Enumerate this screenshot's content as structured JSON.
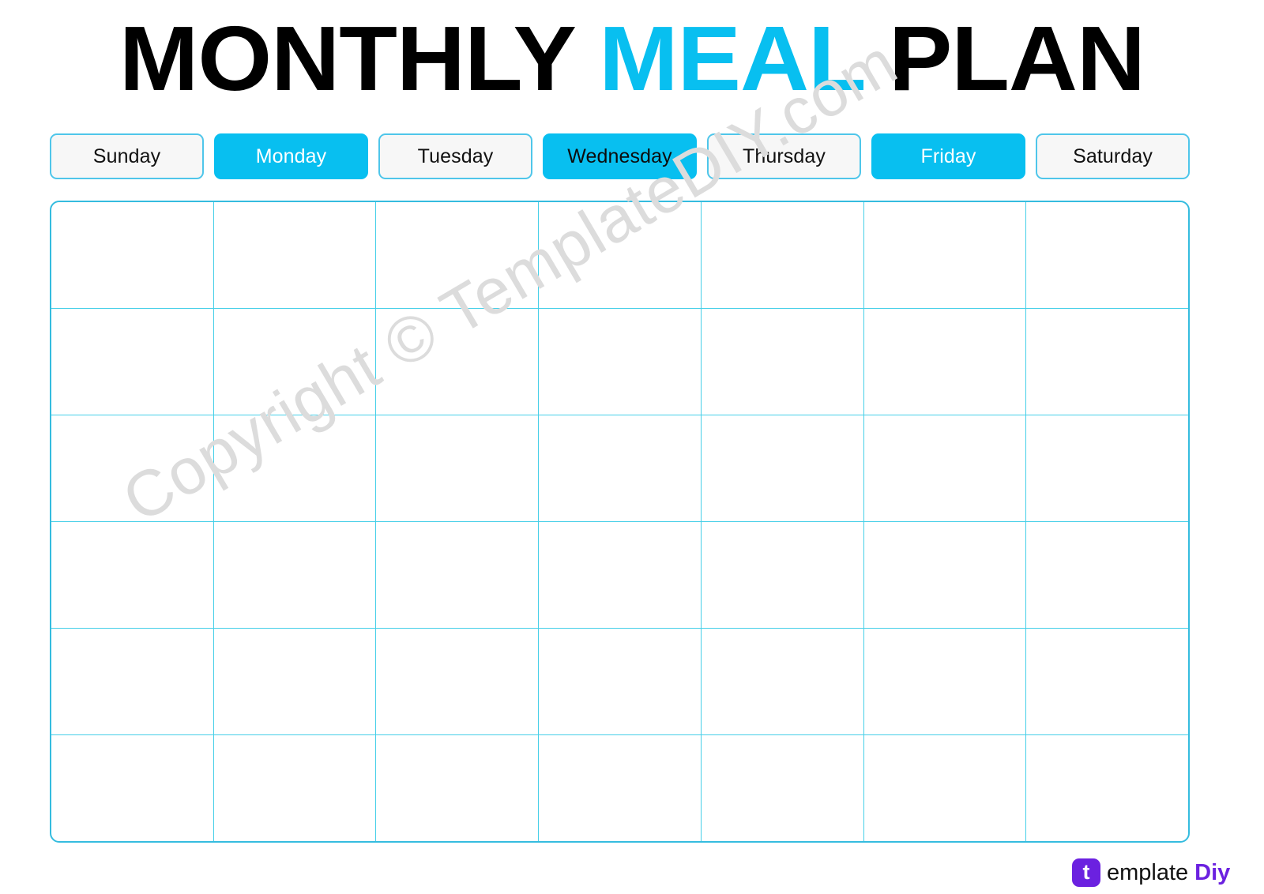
{
  "document": {
    "title_parts": [
      {
        "text": "MONTHLY",
        "accent": false
      },
      {
        "text": "MEAL",
        "accent": true
      },
      {
        "text": "PLAN",
        "accent": false
      }
    ],
    "title_full": "MONTHLY MEAL PLAN"
  },
  "colors": {
    "accent_cyan": "#08bff0",
    "grid_line": "#45cfe8",
    "grid_border": "#35bcdf",
    "button_border": "#4fc6ea",
    "button_fill": "#f7f7f7",
    "text_dark": "#111111",
    "text_light": "#ffffff",
    "watermark": "#dcdcdc",
    "logo_purple": "#6b21e0"
  },
  "day_headers": [
    {
      "label": "Sunday",
      "style": "plain",
      "text_color": "dark"
    },
    {
      "label": "Monday",
      "style": "filled",
      "text_color": "light"
    },
    {
      "label": "Tuesday",
      "style": "plain",
      "text_color": "dark"
    },
    {
      "label": "Wednesday",
      "style": "filled",
      "text_color": "dark"
    },
    {
      "label": "Thursday",
      "style": "plain",
      "text_color": "dark"
    },
    {
      "label": "Friday",
      "style": "filled",
      "text_color": "light"
    },
    {
      "label": "Saturday",
      "style": "plain",
      "text_color": "dark"
    }
  ],
  "grid": {
    "rows": 6,
    "columns": 7,
    "cells": [
      [
        "",
        "",
        "",
        "",
        "",
        "",
        ""
      ],
      [
        "",
        "",
        "",
        "",
        "",
        "",
        ""
      ],
      [
        "",
        "",
        "",
        "",
        "",
        "",
        ""
      ],
      [
        "",
        "",
        "",
        "",
        "",
        "",
        ""
      ],
      [
        "",
        "",
        "",
        "",
        "",
        "",
        ""
      ],
      [
        "",
        "",
        "",
        "",
        "",
        "",
        ""
      ]
    ]
  },
  "watermark": {
    "text": "Copyright © TemplateDIY.com"
  },
  "footer_logo": {
    "badge_letter": "t",
    "word_main": "emplate",
    "word_accent": "Diy"
  }
}
